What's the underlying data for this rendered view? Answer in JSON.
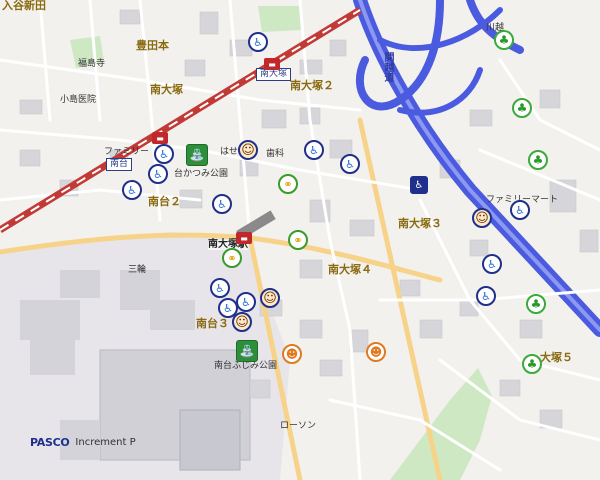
{
  "map": {
    "areas": [
      {
        "id": "iriya-shinden",
        "text": "入谷新田"
      },
      {
        "id": "toyodamoto",
        "text": "豊田本"
      },
      {
        "id": "minami-otsuka-nw",
        "text": "南大塚"
      },
      {
        "id": "minami-otsuka-2",
        "text": "南大塚２"
      },
      {
        "id": "minamidai-2",
        "text": "南台２"
      },
      {
        "id": "minami-otsuka-3",
        "text": "南大塚３"
      },
      {
        "id": "minami-otsuka-4",
        "text": "南大塚４"
      },
      {
        "id": "minamidai-3",
        "text": "南台３"
      },
      {
        "id": "otsuka-5",
        "text": "大塚５"
      }
    ],
    "pois": [
      {
        "id": "fukushima-ji",
        "text": "福島寺"
      },
      {
        "id": "kojima-clinic",
        "text": "小島医院"
      },
      {
        "id": "mitsuwa",
        "text": "三輪"
      },
      {
        "id": "lawson",
        "text": "ローソン"
      },
      {
        "id": "family-mart-w",
        "text": "ファミリー"
      },
      {
        "id": "family-mart-e",
        "text": "ファミリーマート"
      },
      {
        "id": "haseda-dental",
        "text": "はせ"
      },
      {
        "id": "dental",
        "text": "歯科"
      },
      {
        "id": "park-north",
        "text": "台かつみ公園"
      },
      {
        "id": "park-south",
        "text": "南台ふじみ公園"
      },
      {
        "id": "kawagoe",
        "text": "川越"
      },
      {
        "id": "kan-etsu",
        "text": "関越道"
      }
    ],
    "station": {
      "text": "南大塚駅"
    },
    "station_tags": [
      {
        "id": "tag-minami-otsuka",
        "text": "南大塚"
      },
      {
        "id": "tag-minamidai",
        "text": "南台"
      }
    ],
    "markers": {
      "wheelchair": 13,
      "wheelchair_square": 1,
      "bicycle": 3,
      "person": 4,
      "smiley": 2,
      "tree": 4,
      "park": 2,
      "rail_gate": 3
    },
    "attribution": {
      "brand": "PASCO",
      "provider": "Increment P"
    },
    "colors": {
      "land": "#f2f1ee",
      "building": "#d6d6da",
      "railway": "#c23a36",
      "expressway": "#4a5be0",
      "park": "#cfe8c4",
      "major_road": "#f7d38a"
    }
  }
}
